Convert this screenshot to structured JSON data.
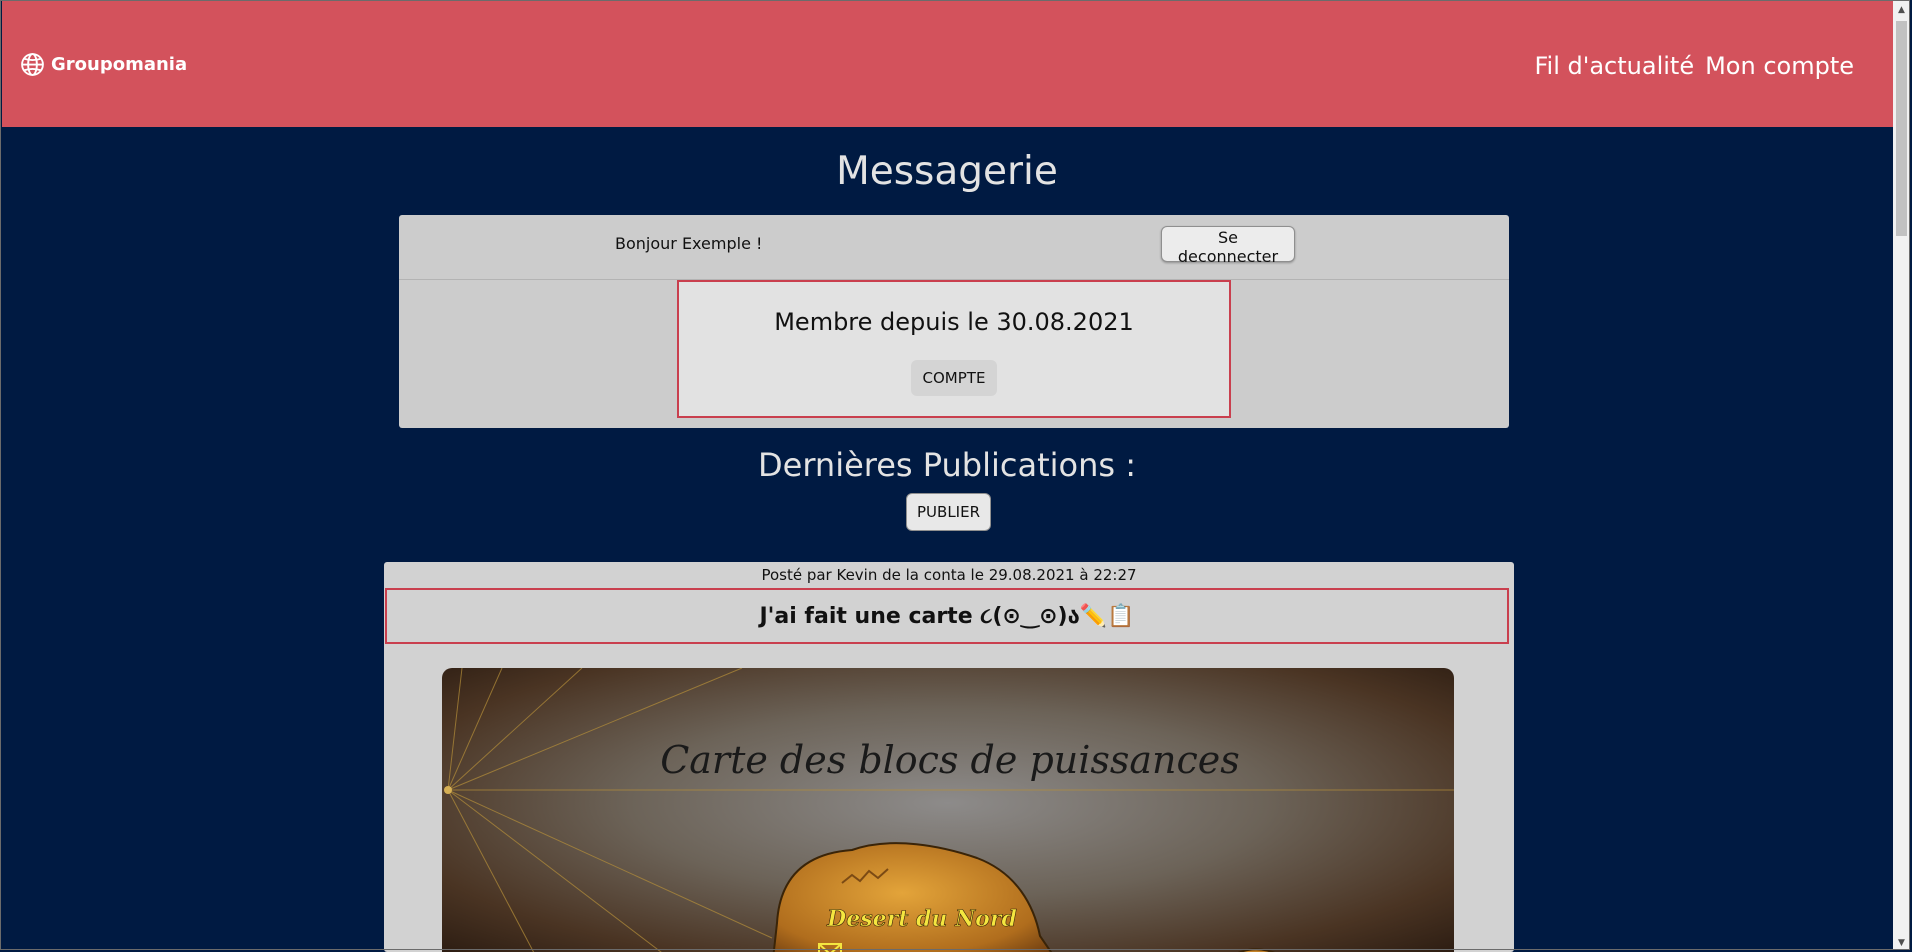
{
  "header": {
    "brand_name": "Groupomania",
    "brand_icon": "globe-icon",
    "nav": [
      "Fil d'actualité",
      "Mon compte"
    ]
  },
  "page_title": "Messagerie",
  "user_panel": {
    "greeting": "Bonjour Exemple !",
    "logout_label": "Se deconnecter",
    "member_since": "Membre depuis le 30.08.2021",
    "account_label": "COMPTE"
  },
  "feed": {
    "title": "Dernières Publications :",
    "publish_label": "PUBLIER"
  },
  "post": {
    "meta": "Posté par Kevin de la conta le 29.08.2021 à 22:27",
    "title": "J'ai fait une carte ૮(⊙‿⊙)ა✏️📋",
    "image": {
      "map_title": "Carte des blocs de puissances",
      "region_label": "Desert du Nord"
    }
  },
  "colors": {
    "header": "#d3525c",
    "background": "#001a42",
    "accent_border": "#c93f4e"
  }
}
